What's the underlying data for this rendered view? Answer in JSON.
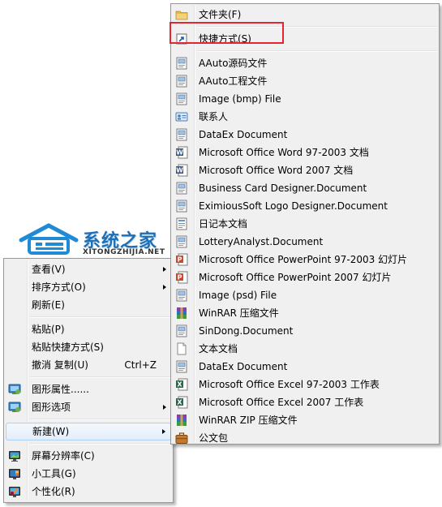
{
  "logo": {
    "name": "系统之家",
    "domain": "XITONGZHIJIA.NET"
  },
  "context_menu": {
    "items": [
      {
        "label": "查看(V)",
        "submenu": true
      },
      {
        "label": "排序方式(O)",
        "submenu": true
      },
      {
        "label": "刷新(E)"
      },
      {
        "label": "粘贴(P)"
      },
      {
        "label": "粘贴快捷方式(S)"
      },
      {
        "label": "撤消 复制(U)",
        "shortcut": "Ctrl+Z"
      },
      {
        "label": "图形属性......",
        "icon": "intel-graphics-icon"
      },
      {
        "label": "图形选项",
        "icon": "intel-graphics-icon",
        "submenu": true
      },
      {
        "label": "新建(W)",
        "submenu": true
      },
      {
        "label": "屏幕分辨率(C)",
        "icon": "monitor-icon"
      },
      {
        "label": "小工具(G)",
        "icon": "gadgets-icon"
      },
      {
        "label": "个性化(R)",
        "icon": "personalize-icon"
      }
    ]
  },
  "new_submenu": {
    "items": [
      {
        "label": "文件夹(F)",
        "icon": "folder-icon"
      },
      {
        "label": "快捷方式(S)",
        "icon": "shortcut-icon"
      },
      {
        "label": "AAuto源码文件",
        "icon": "generic-doc-icon"
      },
      {
        "label": "AAuto工程文件",
        "icon": "generic-doc-icon"
      },
      {
        "label": "Image (bmp) File",
        "icon": "generic-doc-icon"
      },
      {
        "label": "联系人",
        "icon": "contact-card-icon"
      },
      {
        "label": "DataEx Document",
        "icon": "generic-doc-icon"
      },
      {
        "label": "Microsoft Office Word 97-2003 文档",
        "icon": "word-doc-icon"
      },
      {
        "label": "Microsoft Office Word 2007 文档",
        "icon": "word-doc-icon"
      },
      {
        "label": "Business Card Designer.Document",
        "icon": "generic-doc-icon"
      },
      {
        "label": "EximiousSoft Logo Designer.Document",
        "icon": "generic-doc-icon"
      },
      {
        "label": "日记本文档",
        "icon": "diary-doc-icon"
      },
      {
        "label": "LotteryAnalyst.Document",
        "icon": "generic-doc-icon"
      },
      {
        "label": "Microsoft Office PowerPoint 97-2003 幻灯片",
        "icon": "powerpoint-doc-icon"
      },
      {
        "label": "Microsoft Office PowerPoint 2007 幻灯片",
        "icon": "powerpoint-doc-icon"
      },
      {
        "label": "Image (psd) File",
        "icon": "generic-doc-icon"
      },
      {
        "label": "WinRAR 压缩文件",
        "icon": "winrar-icon"
      },
      {
        "label": "SinDong.Document",
        "icon": "generic-doc-icon"
      },
      {
        "label": "文本文档",
        "icon": "text-doc-icon"
      },
      {
        "label": "DataEx Document",
        "icon": "generic-doc-icon"
      },
      {
        "label": "Microsoft Office Excel 97-2003 工作表",
        "icon": "excel-doc-icon"
      },
      {
        "label": "Microsoft Office Excel 2007 工作表",
        "icon": "excel-doc-icon"
      },
      {
        "label": "WinRAR ZIP 压缩文件",
        "icon": "winrar-icon"
      },
      {
        "label": "公文包",
        "icon": "briefcase-icon"
      }
    ]
  },
  "colors": {
    "menu_bg": "#f0f0f0",
    "menu_border": "#979797",
    "highlight_border": "#aecff7",
    "annotation_red": "#e3262f",
    "logo_blue": "#1f6fb5"
  }
}
